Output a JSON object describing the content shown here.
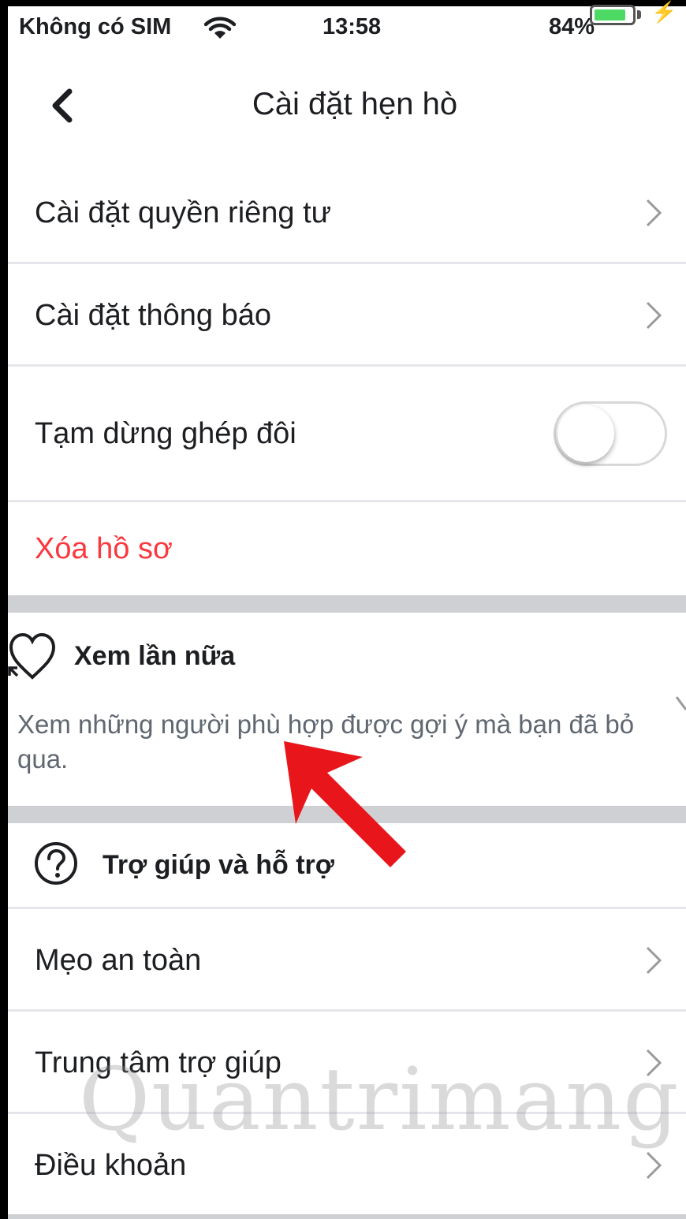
{
  "status_bar": {
    "carrier": "Không có SIM",
    "time": "13:58",
    "battery_percent": "84%",
    "battery_level": 0.84,
    "battery_color": "#4cd964"
  },
  "navbar": {
    "title": "Cài đặt hẹn hò",
    "back_icon": "chevron-left-icon"
  },
  "settings": {
    "privacy": "Cài đặt quyền riêng tư",
    "notifications": "Cài đặt thông báo",
    "pause_matching": "Tạm dừng ghép đôi",
    "pause_matching_on": false,
    "delete_profile": "Xóa hồ sơ",
    "delete_color": "#fa383e"
  },
  "second_look": {
    "title": "Xem lần nữa",
    "description": "Xem những người phù hợp được gợi ý mà bạn đã bỏ qua.",
    "icon": "heart-return-icon"
  },
  "help": {
    "title": "Trợ giúp và hỗ trợ",
    "icon": "question-circle-icon",
    "items": [
      {
        "label": "Mẹo an toàn"
      },
      {
        "label": "Trung tâm trợ giúp"
      },
      {
        "label": "Điều khoản"
      }
    ]
  },
  "watermark": "Quantrimang",
  "annotation_color": "#e8161b"
}
